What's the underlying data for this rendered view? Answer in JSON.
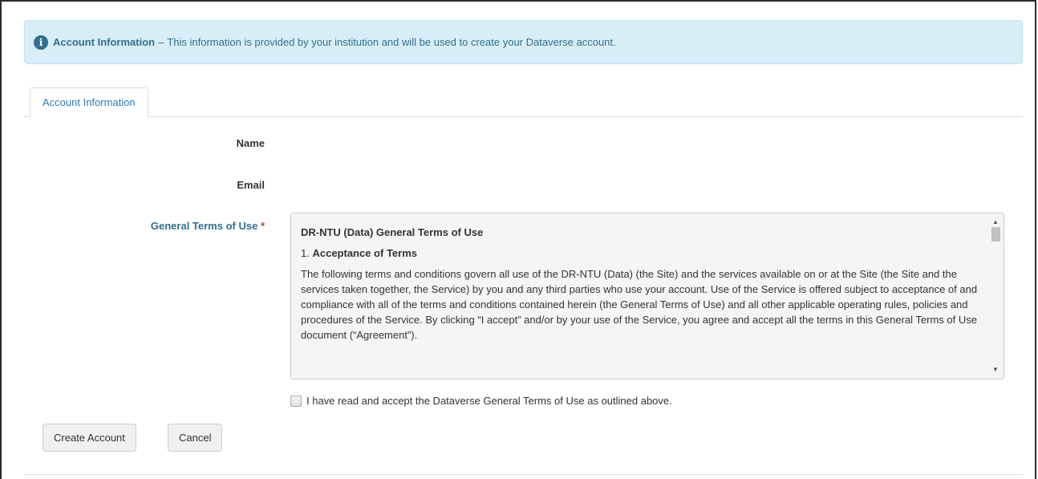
{
  "alert": {
    "icon": "info-circle-icon",
    "title": "Account Information",
    "separator": "–",
    "message": "This information is provided by your institution and will be used to create your Dataverse account."
  },
  "tabs": [
    {
      "label": "Account Information",
      "active": true
    }
  ],
  "form": {
    "name_label": "Name",
    "name_value": "",
    "email_label": "Email",
    "email_value": "",
    "terms_label": "General Terms of Use",
    "required_marker": "*"
  },
  "terms": {
    "heading": "DR-NTU (Data) General Terms of Use",
    "section_number": "1.",
    "section_title": "Acceptance of Terms",
    "body": "The following terms and conditions govern all use of the DR-NTU (Data) (the Site) and the services available on or at the Site (the Site and the services taken together, the Service) by you and any third parties who use your account. Use of the Service is offered subject to acceptance of and compliance with all of the terms and conditions contained herein (the General Terms of Use) and all other applicable operating rules, policies and procedures of the Service. By clicking “I accept” and/or by your use of the Service, you agree and accept all the terms in this General Terms of Use document (“Agreement”).",
    "scroll_up_icon": "scroll-up-arrow-icon",
    "scroll_down_icon": "scroll-down-arrow-icon"
  },
  "accept": {
    "checked": false,
    "label": "I have read and accept the Dataverse General Terms of Use as outlined above."
  },
  "buttons": {
    "create": "Create Account",
    "cancel": "Cancel"
  },
  "colors": {
    "alert_bg": "#d9edf7",
    "alert_text": "#31708f",
    "link": "#337ab7",
    "required": "#a94442"
  }
}
